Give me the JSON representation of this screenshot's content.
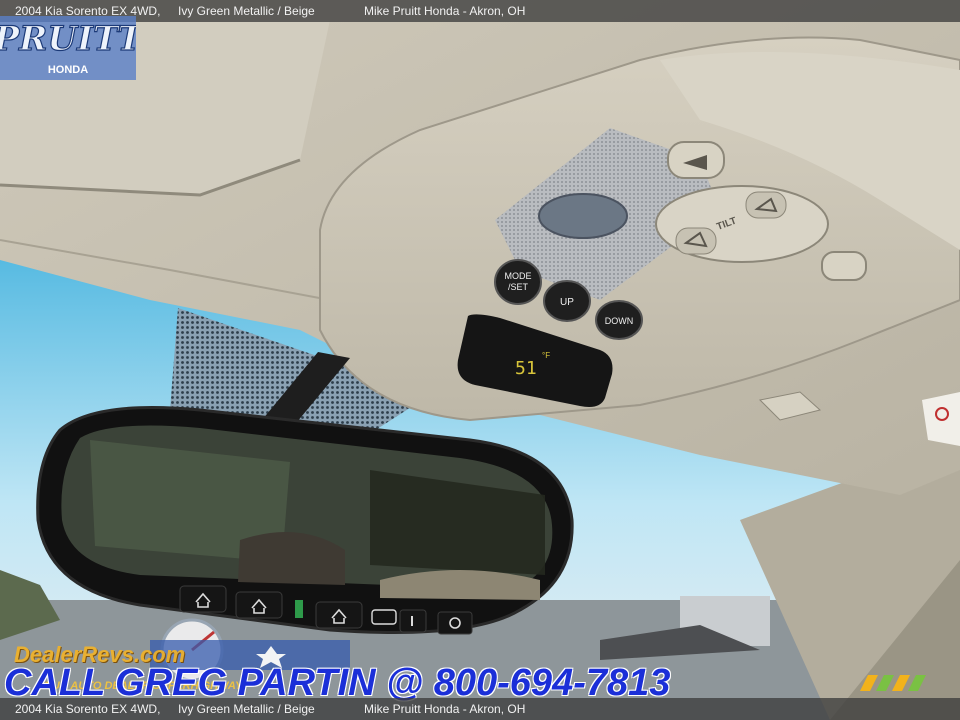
{
  "caption": {
    "model": "2004 Kia Sorento EX 4WD,",
    "colors": "Ivy Green Metallic / Beige",
    "dealer": "Mike Pruitt Honda - Akron, OH"
  },
  "logo": {
    "word": "PRUITT",
    "sub": "HONDA"
  },
  "console": {
    "buttons": {
      "mode": "MODE\n/SET",
      "up": "UP",
      "down": "DOWN"
    },
    "temperature": "51",
    "temp_unit": "°F",
    "sunroof_label": "TILT"
  },
  "watermark": {
    "main": "DealerRevs.com",
    "sub": "YOUR AUTO DEALER SUPERHIGHWAY"
  },
  "banner": {
    "text": "CALL GREG PARTIN @ 800-694-7813"
  },
  "colors": {
    "banner_text": "#1b2fd8",
    "caption_bar": "#3c3c3c",
    "headliner": "#c9c4b4"
  },
  "icons": [
    "dome-light-icon",
    "garage-door-icon",
    "auto-dim-icon",
    "sunroof-tilt-icon",
    "mirror-icon"
  ]
}
